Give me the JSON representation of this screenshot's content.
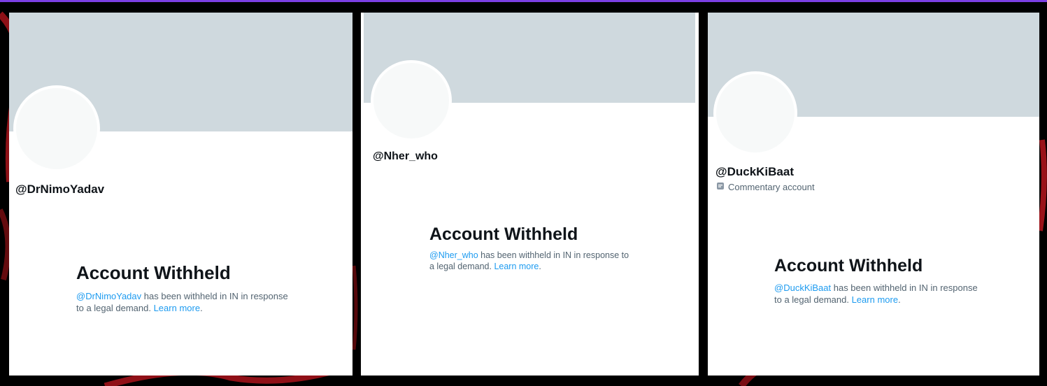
{
  "colors": {
    "banner": "#cfd9de",
    "link": "#1d9bf0",
    "text": "#0f1419",
    "secondary": "#536471",
    "accent_line": "#7b3fe4"
  },
  "panels": [
    {
      "handle": "@DrNimoYadav",
      "title": "Account Withheld",
      "mention": "@DrNimoYadav",
      "message_rest": " has been withheld in IN in response to a legal demand. ",
      "learn_more": "Learn more",
      "period": "."
    },
    {
      "handle": "@Nher_who",
      "title": "Account Withheld",
      "mention": "@Nher_who",
      "message_rest": " has been withheld in IN in response to a legal demand. ",
      "learn_more": "Learn more",
      "period": "."
    },
    {
      "handle": "@DuckKiBaat",
      "subtitle": "Commentary account",
      "subtitle_icon": "commentary-badge-icon",
      "title": "Account Withheld",
      "mention": "@DuckKiBaat",
      "message_rest": " has been withheld in IN in response to a legal demand. ",
      "learn_more": "Learn more",
      "period": "."
    }
  ]
}
